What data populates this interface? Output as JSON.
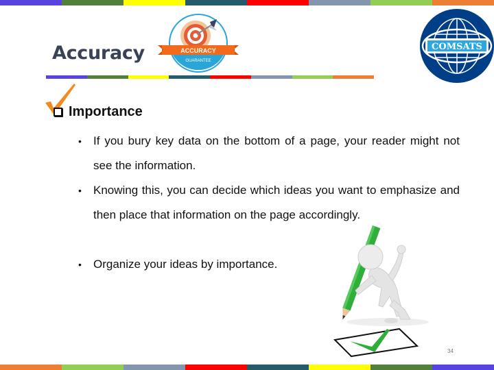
{
  "slide": {
    "title": "Accuracy",
    "page_number": "34"
  },
  "badge": {
    "top_text": "ACCURACY",
    "bottom_text": "GUARANTEE"
  },
  "logo": {
    "text": "COMSATS"
  },
  "section": {
    "heading": "Importance",
    "bullets": [
      "If you bury key data on the bottom of a page, your reader might not see the information.",
      "Knowing this, you can decide which ideas you want to emphasize and then place that information on the page accordingly.",
      "Organize your ideas by importance."
    ],
    "bullet_glyph": "•"
  },
  "colors": {
    "stripe": [
      "#5744e0",
      "#527f3a",
      "#ffff00",
      "#245c6b",
      "#ff0000",
      "#8496ad",
      "#92cd55",
      "#ed7f34"
    ],
    "title_text": "#3a4356",
    "badge_orange": "#f26a1b",
    "badge_blue": "#2aa5d8",
    "logo_blue": "#003f87",
    "check_orange": "#f38a1d",
    "pencil_green": "#2fae3a"
  }
}
